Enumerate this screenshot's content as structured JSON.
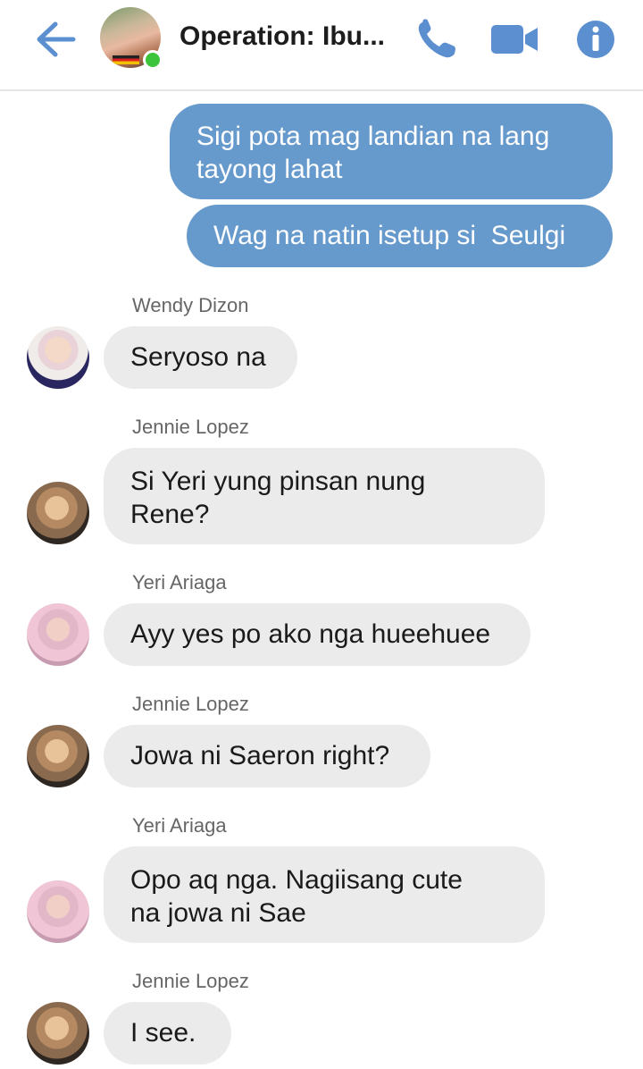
{
  "header": {
    "title": "Operation: Ibu...",
    "back_icon": "arrow-left-icon",
    "call_icon": "phone-icon",
    "video_icon": "video-camera-icon",
    "info_icon": "info-icon",
    "accent_color": "#5b8fd0",
    "online_color": "#3cc43c"
  },
  "messages": [
    {
      "direction": "outgoing",
      "lines": [
        "Sigi pota mag landian na lang",
        "tayong lahat"
      ]
    },
    {
      "direction": "outgoing",
      "lines": [
        "Wag na natin isetup si  Seulgi"
      ]
    },
    {
      "direction": "incoming",
      "sender": "Wendy Dizon",
      "lines": [
        "Seryoso na"
      ]
    },
    {
      "direction": "incoming",
      "sender": "Jennie Lopez",
      "lines": [
        "Si Yeri yung pinsan nung",
        "Rene?"
      ]
    },
    {
      "direction": "incoming",
      "sender": "Yeri Ariaga",
      "lines": [
        "Ayy yes po ako nga hueehuee"
      ]
    },
    {
      "direction": "incoming",
      "sender": "Jennie Lopez",
      "lines": [
        "Jowa ni Saeron right?"
      ]
    },
    {
      "direction": "incoming",
      "sender": "Yeri Ariaga",
      "lines": [
        "Opo aq nga. Nagiisang cute",
        "na jowa ni Sae"
      ]
    },
    {
      "direction": "incoming",
      "sender": "Jennie Lopez",
      "lines": [
        "I see."
      ]
    }
  ],
  "colors": {
    "outgoing_bubble": "#6699cc",
    "incoming_bubble": "#ebebeb",
    "sender_text": "#666666"
  }
}
